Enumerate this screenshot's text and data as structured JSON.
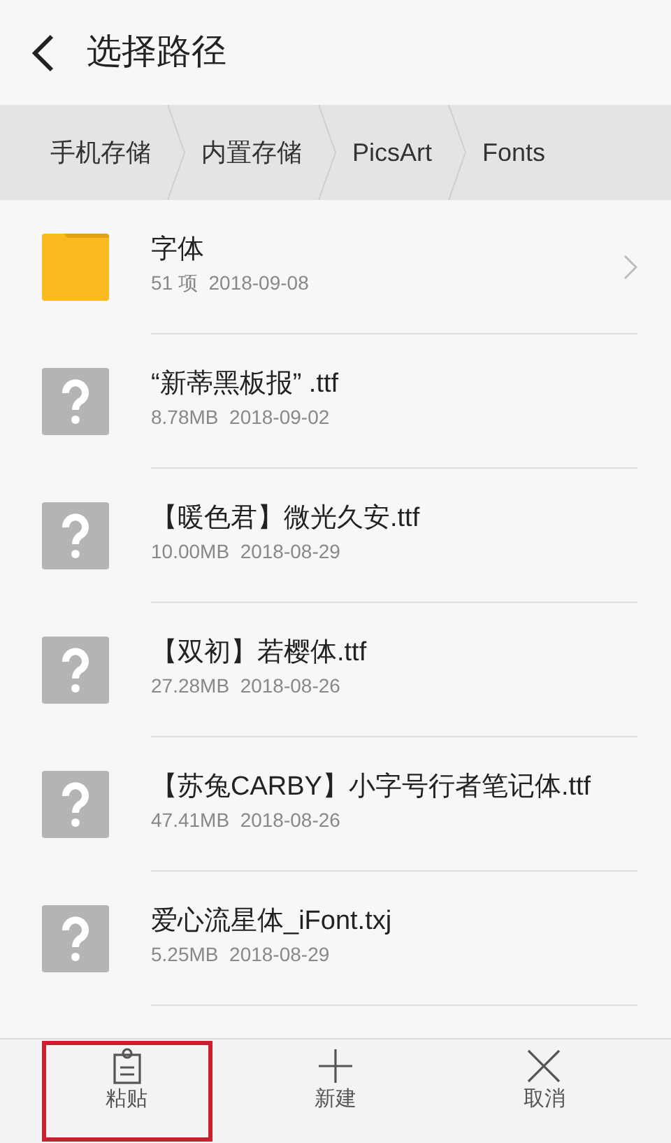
{
  "header": {
    "title": "选择路径"
  },
  "breadcrumb": [
    "手机存储",
    "内置存储",
    "PicsArt",
    "Fonts"
  ],
  "items": [
    {
      "kind": "folder",
      "name": "字体",
      "meta": "51 项  2018-09-08"
    },
    {
      "kind": "unknown",
      "name": "“新蒂黑板报” .ttf",
      "meta": "8.78MB  2018-09-02"
    },
    {
      "kind": "unknown",
      "name": "【暖色君】微光久安.ttf",
      "meta": "10.00MB  2018-08-29"
    },
    {
      "kind": "unknown",
      "name": "【双初】若樱体.ttf",
      "meta": "27.28MB  2018-08-26"
    },
    {
      "kind": "unknown",
      "name": "【苏兔CARBY】小字号行者笔记体.ttf",
      "meta": "47.41MB  2018-08-26"
    },
    {
      "kind": "unknown",
      "name": "爱心流星体_iFont.txj",
      "meta": "5.25MB  2018-08-29"
    }
  ],
  "actions": [
    {
      "kind": "paste",
      "label": "粘贴",
      "highlighted": true
    },
    {
      "kind": "new",
      "label": "新建",
      "highlighted": false
    },
    {
      "kind": "cancel",
      "label": "取消",
      "highlighted": false
    }
  ]
}
